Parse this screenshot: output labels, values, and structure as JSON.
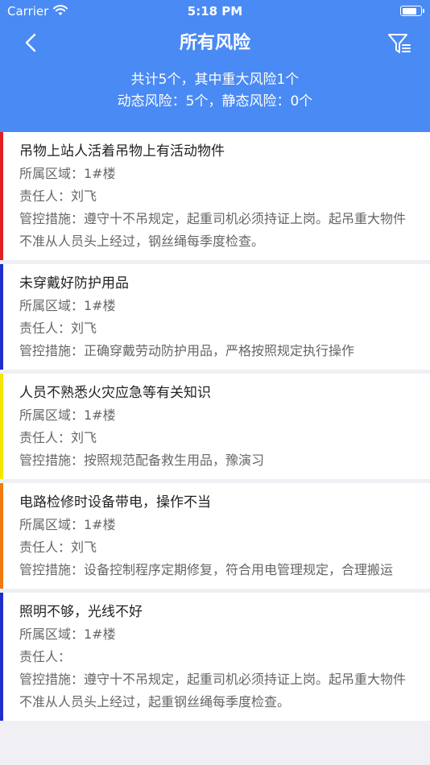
{
  "status_bar": {
    "carrier": "Carrier",
    "time": "5:18 PM",
    "battery_level": 0.85
  },
  "nav": {
    "title": "所有风险"
  },
  "summary": {
    "line1": "共计5个，其中重大风险1个",
    "line2": "动态风险：5个，静态风险：0个"
  },
  "risks": [
    {
      "title": "吊物上站人活着吊物上有活动物件",
      "area": "所属区域：1#楼",
      "owner": "责任人：刘飞",
      "measure": "管控措施：遵守十不吊规定，起重司机必须持证上岗。起吊重大物件不准从人员头上经过，钢丝绳每季度检查。",
      "level_color": "#e02020"
    },
    {
      "title": "未穿戴好防护用品",
      "area": "所属区域：1#楼",
      "owner": "责任人：刘飞",
      "measure": "管控措施：正确穿戴劳动防护用品，严格按照规定执行操作",
      "level_color": "#1f2fc8"
    },
    {
      "title": "人员不熟悉火灾应急等有关知识",
      "area": "所属区域：1#楼",
      "owner": "责任人：刘飞",
      "measure": "管控措施：按照规范配备救生用品，豫演习",
      "level_color": "#f5e600"
    },
    {
      "title": "电路检修时设备带电，操作不当",
      "area": "所属区域：1#楼",
      "owner": "责任人：刘飞",
      "measure": "管控措施：设备控制程序定期修复，符合用电管理规定，合理搬运",
      "level_color": "#f07a10"
    },
    {
      "title": "照明不够，光线不好",
      "area": "所属区域：1#楼",
      "owner": "责任人：",
      "measure": "管控措施：遵守十不吊规定，起重司机必须持证上岗。起吊重大物件不准从人员头上经过，起重钢丝绳每季度检查。",
      "level_color": "#1f2fc8"
    }
  ]
}
